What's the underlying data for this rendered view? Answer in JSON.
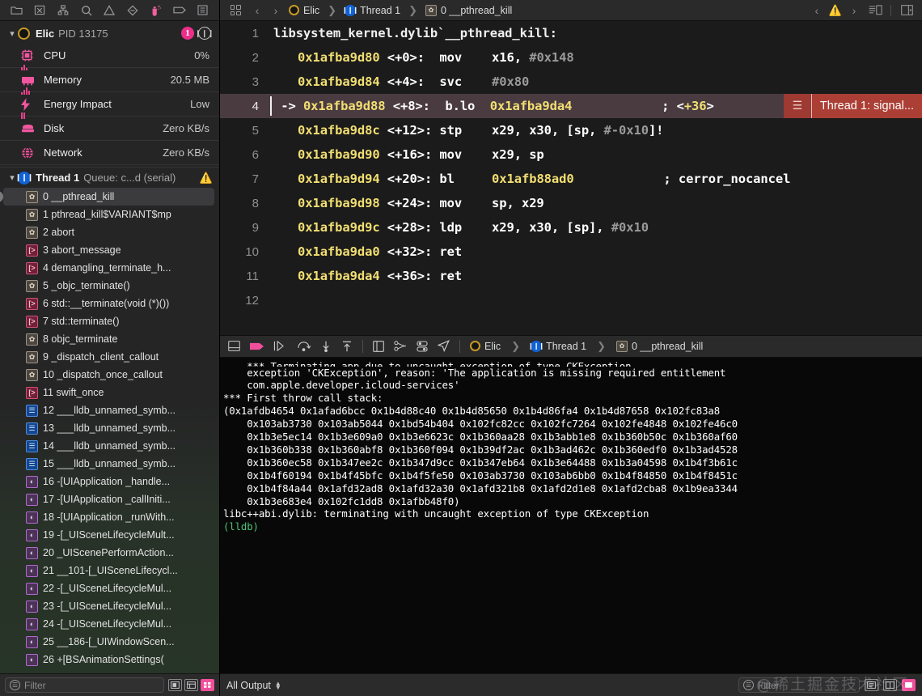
{
  "sidebar": {
    "toolbar_icons": [
      {
        "name": "folder-icon",
        "label": "Project navigator"
      },
      {
        "name": "source-control-icon",
        "label": "Source control navigator"
      },
      {
        "name": "hierarchy-icon",
        "label": "Symbol navigator"
      },
      {
        "name": "search-icon",
        "label": "Find navigator"
      },
      {
        "name": "warning-icon",
        "label": "Issue navigator"
      },
      {
        "name": "diamond-icon",
        "label": "Test navigator"
      },
      {
        "name": "debug-icon",
        "label": "Debug navigator"
      },
      {
        "name": "breakpoint-icon",
        "label": "Breakpoint navigator"
      },
      {
        "name": "report-icon",
        "label": "Report navigator"
      }
    ],
    "process": {
      "name": "Elic",
      "pid": "PID 13175",
      "badge_count": "1",
      "pause_icon": "pause-icon"
    },
    "gauges": [
      {
        "icon": "cpu-icon",
        "label": "CPU",
        "value": "0%"
      },
      {
        "icon": "memory-icon",
        "label": "Memory",
        "value": "20.5 MB"
      },
      {
        "icon": "energy-icon",
        "label": "Energy Impact",
        "value": "Low"
      },
      {
        "icon": "disk-icon",
        "label": "Disk",
        "value": "Zero KB/s"
      },
      {
        "icon": "network-icon",
        "label": "Network",
        "value": "Zero KB/s"
      }
    ],
    "thread": {
      "name": "Thread 1",
      "queue": "Queue: c...d (serial)",
      "warning_icon": "warning-triangle-icon"
    },
    "frames": [
      {
        "index": "0",
        "text": "0 __pthread_kill",
        "kind": "gear",
        "selected": true
      },
      {
        "index": "1",
        "text": "1 pthread_kill$VARIANT$mp",
        "kind": "gear",
        "selected": false
      },
      {
        "index": "2",
        "text": "2 abort",
        "kind": "gear",
        "selected": false
      },
      {
        "index": "3",
        "text": "3 abort_message",
        "kind": "src",
        "selected": false
      },
      {
        "index": "4",
        "text": "4 demangling_terminate_h...",
        "kind": "src",
        "selected": false
      },
      {
        "index": "5",
        "text": "5 _objc_terminate()",
        "kind": "gear",
        "selected": false
      },
      {
        "index": "6",
        "text": "6 std::__terminate(void (*)())",
        "kind": "src",
        "selected": false
      },
      {
        "index": "7",
        "text": "7 std::terminate()",
        "kind": "src",
        "selected": false
      },
      {
        "index": "8",
        "text": "8 objc_terminate",
        "kind": "gear",
        "selected": false
      },
      {
        "index": "9",
        "text": "9 _dispatch_client_callout",
        "kind": "gear",
        "selected": false
      },
      {
        "index": "10",
        "text": "10 _dispatch_once_callout",
        "kind": "gear",
        "selected": false
      },
      {
        "index": "11",
        "text": "11 swift_once",
        "kind": "src",
        "selected": false
      },
      {
        "index": "12",
        "text": "12 ___lldb_unnamed_symb...",
        "kind": "person",
        "selected": false
      },
      {
        "index": "13",
        "text": "13 ___lldb_unnamed_symb...",
        "kind": "person",
        "selected": false
      },
      {
        "index": "14",
        "text": "14 ___lldb_unnamed_symb...",
        "kind": "person",
        "selected": false
      },
      {
        "index": "15",
        "text": "15 ___lldb_unnamed_symb...",
        "kind": "person",
        "selected": false
      },
      {
        "index": "16",
        "text": "16 -[UIApplication _handle...",
        "kind": "objc",
        "selected": false
      },
      {
        "index": "17",
        "text": "17 -[UIApplication _callIniti...",
        "kind": "objc",
        "selected": false
      },
      {
        "index": "18",
        "text": "18 -[UIApplication _runWith...",
        "kind": "objc",
        "selected": false
      },
      {
        "index": "19",
        "text": "19 -[_UISceneLifecycleMult...",
        "kind": "objc",
        "selected": false
      },
      {
        "index": "20",
        "text": "20 _UIScenePerformAction...",
        "kind": "objc",
        "selected": false
      },
      {
        "index": "21",
        "text": "21 __101-[_UISceneLifecycl...",
        "kind": "objc",
        "selected": false
      },
      {
        "index": "22",
        "text": "22 -[_UISceneLifecycleMul...",
        "kind": "objc",
        "selected": false
      },
      {
        "index": "23",
        "text": "23 -[_UISceneLifecycleMul...",
        "kind": "objc",
        "selected": false
      },
      {
        "index": "24",
        "text": "24 -[_UISceneLifecycleMul...",
        "kind": "objc",
        "selected": false
      },
      {
        "index": "25",
        "text": "25 __186-[_UIWindowScen...",
        "kind": "objc",
        "selected": false
      },
      {
        "index": "26",
        "text": "26 +[BSAnimationSettings(",
        "kind": "objc",
        "selected": false
      }
    ],
    "filter": {
      "placeholder": "Filter",
      "icon": "filter-icon",
      "buttons": [
        "show-only-crashed-icon",
        "show-all-frames-icon",
        "show-debug-levels-icon"
      ]
    }
  },
  "editor": {
    "toolbar": {
      "grid_icon": "multi-pane-icon",
      "back_icon": "chevron-left-icon",
      "forward_icon": "chevron-right-icon",
      "breadcrumbs": [
        {
          "label": "Elic",
          "icon": "process-dot-icon"
        },
        {
          "label": "Thread 1",
          "icon": "thread-icon"
        },
        {
          "label": "0 __pthread_kill",
          "icon": "gear-icon"
        }
      ],
      "issue_prev_icon": "chevron-left-icon",
      "issue_icon": "warning-triangle-icon",
      "issue_next_icon": "chevron-right-icon",
      "assistant_icon": "assistant-editor-icon",
      "inspector_icon": "show-inspector-icon"
    },
    "lines": [
      {
        "num": "1",
        "indent": 0,
        "highlighted": false,
        "parts": [
          {
            "cls": "c-sym",
            "t": "libsystem_kernel.dylib`__pthread_kill:"
          }
        ]
      },
      {
        "num": "2",
        "indent": 1,
        "highlighted": false,
        "parts": [
          {
            "cls": "c-addr",
            "t": "0x1afba9d80 "
          },
          {
            "cls": "c-off",
            "t": "<+0>:  "
          },
          {
            "cls": "c-mn",
            "t": "mov    x16, "
          },
          {
            "cls": "c-imm",
            "t": "#0x148"
          }
        ]
      },
      {
        "num": "3",
        "indent": 1,
        "highlighted": false,
        "parts": [
          {
            "cls": "c-addr",
            "t": "0x1afba9d84 "
          },
          {
            "cls": "c-off",
            "t": "<+4>:  "
          },
          {
            "cls": "c-mn",
            "t": "svc    "
          },
          {
            "cls": "c-imm",
            "t": "#0x80"
          }
        ]
      },
      {
        "num": "4",
        "indent": 0,
        "highlighted": true,
        "pc": true,
        "parts": [
          {
            "cls": "arrow-mark",
            "t": " -> "
          },
          {
            "cls": "c-addr",
            "t": "0x1afba9d88 "
          },
          {
            "cls": "c-off",
            "t": "<+8>:  "
          },
          {
            "cls": "c-mn",
            "t": "b.lo  "
          },
          {
            "cls": "c-addr",
            "t": "0x1afba9da4"
          },
          {
            "cls": "c-imm",
            "t": "            "
          },
          {
            "cls": "c-cmt",
            "t": "; "
          },
          {
            "cls": "c-off",
            "t": "<"
          },
          {
            "cls": "c-addr",
            "t": "+36"
          },
          {
            "cls": "c-off",
            "t": ">"
          }
        ]
      },
      {
        "num": "5",
        "indent": 1,
        "highlighted": false,
        "parts": [
          {
            "cls": "c-addr",
            "t": "0x1afba9d8c "
          },
          {
            "cls": "c-off",
            "t": "<+12>: "
          },
          {
            "cls": "c-mn",
            "t": "stp    x29, x30, [sp, "
          },
          {
            "cls": "c-imm",
            "t": "#-0x10"
          },
          {
            "cls": "c-mn",
            "t": "]!"
          }
        ]
      },
      {
        "num": "6",
        "indent": 1,
        "highlighted": false,
        "parts": [
          {
            "cls": "c-addr",
            "t": "0x1afba9d90 "
          },
          {
            "cls": "c-off",
            "t": "<+16>: "
          },
          {
            "cls": "c-mn",
            "t": "mov    x29, sp"
          }
        ]
      },
      {
        "num": "7",
        "indent": 1,
        "highlighted": false,
        "parts": [
          {
            "cls": "c-addr",
            "t": "0x1afba9d94 "
          },
          {
            "cls": "c-off",
            "t": "<+20>: "
          },
          {
            "cls": "c-mn",
            "t": "bl     "
          },
          {
            "cls": "c-addr",
            "t": "0x1afb88ad0"
          },
          {
            "cls": "c-mn",
            "t": "            ; cerror_nocancel"
          }
        ]
      },
      {
        "num": "8",
        "indent": 1,
        "highlighted": false,
        "parts": [
          {
            "cls": "c-addr",
            "t": "0x1afba9d98 "
          },
          {
            "cls": "c-off",
            "t": "<+24>: "
          },
          {
            "cls": "c-mn",
            "t": "mov    sp, x29"
          }
        ]
      },
      {
        "num": "9",
        "indent": 1,
        "highlighted": false,
        "parts": [
          {
            "cls": "c-addr",
            "t": "0x1afba9d9c "
          },
          {
            "cls": "c-off",
            "t": "<+28>: "
          },
          {
            "cls": "c-mn",
            "t": "ldp    x29, x30, [sp], "
          },
          {
            "cls": "c-imm",
            "t": "#0x10"
          }
        ]
      },
      {
        "num": "10",
        "indent": 1,
        "highlighted": false,
        "parts": [
          {
            "cls": "c-addr",
            "t": "0x1afba9da0 "
          },
          {
            "cls": "c-off",
            "t": "<+32>: "
          },
          {
            "cls": "c-mn",
            "t": "ret"
          }
        ]
      },
      {
        "num": "11",
        "indent": 1,
        "highlighted": false,
        "parts": [
          {
            "cls": "c-addr",
            "t": "0x1afba9da4 "
          },
          {
            "cls": "c-off",
            "t": "<+36>: "
          },
          {
            "cls": "c-mn",
            "t": "ret"
          }
        ]
      },
      {
        "num": "12",
        "indent": 0,
        "highlighted": false,
        "parts": []
      }
    ],
    "error_annotation": {
      "grip_icon": "hamburger-icon",
      "message": "Thread 1: signal..."
    }
  },
  "console": {
    "toolbar": {
      "icons": [
        {
          "name": "hide-console-icon"
        },
        {
          "name": "stop-icon"
        },
        {
          "name": "continue-icon"
        },
        {
          "name": "step-over-icon"
        },
        {
          "name": "step-into-icon"
        },
        {
          "name": "step-out-icon"
        },
        {
          "name": "debug-view-hierarchy-icon"
        },
        {
          "name": "debug-memory-graph-icon"
        },
        {
          "name": "environment-overrides-icon"
        },
        {
          "name": "simulate-location-icon"
        }
      ],
      "breadcrumbs": [
        {
          "label": "Elic",
          "icon": "process-dot-icon"
        },
        {
          "label": "Thread 1",
          "icon": "thread-icon"
        },
        {
          "label": "0 __pthread_kill",
          "icon": "gear-icon"
        }
      ]
    },
    "output_lines": [
      "    exception 'CKException', reason: 'The application is missing required entitlement",
      "    com.apple.developer.icloud-services'",
      "*** First throw call stack:",
      "(0x1afdb4654 0x1afad6bcc 0x1b4d88c40 0x1b4d85650 0x1b4d86fa4 0x1b4d87658 0x102fc83a8",
      "    0x103ab3730 0x103ab5044 0x1bd54b404 0x102fc82cc 0x102fc7264 0x102fe4848 0x102fe46c0",
      "    0x1b3e5ec14 0x1b3e609a0 0x1b3e6623c 0x1b360aa28 0x1b3abb1e8 0x1b360b50c 0x1b360af60",
      "    0x1b360b338 0x1b360abf8 0x1b360f094 0x1b39df2ac 0x1b3ad462c 0x1b360edf0 0x1b3ad4528",
      "    0x1b360ec58 0x1b347ee2c 0x1b347d9cc 0x1b347eb64 0x1b3e64488 0x1b3a04598 0x1b4f3b61c",
      "    0x1b4f60194 0x1b4f45bfc 0x1b4f5fe50 0x103ab3730 0x103ab6bb0 0x1b4f84850 0x1b4f8451c",
      "    0x1b4f84a44 0x1afd32ad8 0x1afd32a30 0x1afd321b8 0x1afd2d1e8 0x1afd2cba8 0x1b9ea3344",
      "    0x1b3e683e4 0x102fc1dd8 0x1afbb48f0)",
      "libc++abi.dylib: terminating with uncaught exception of type CKException"
    ],
    "prompt": "(lldb)"
  },
  "status_bar": {
    "output_scope": "All Output",
    "stepper_icon": "up-down-stepper-icon",
    "filter": {
      "placeholder": "Filter",
      "icon": "filter-icon"
    },
    "buttons": [
      "clear-console-icon",
      "split-console-icon",
      "toggle-console-icon"
    ]
  },
  "watermark": "@稀土掘金技术社区",
  "colors": {
    "accent_pink": "#f0509b",
    "highlight_row": "#4a3b41",
    "error_red": "#ab3f35",
    "address_yellow": "#f2df72",
    "lldb_green": "#4ec07a",
    "thread_blue": "#1062d6",
    "process_gold": "#c79a22"
  }
}
